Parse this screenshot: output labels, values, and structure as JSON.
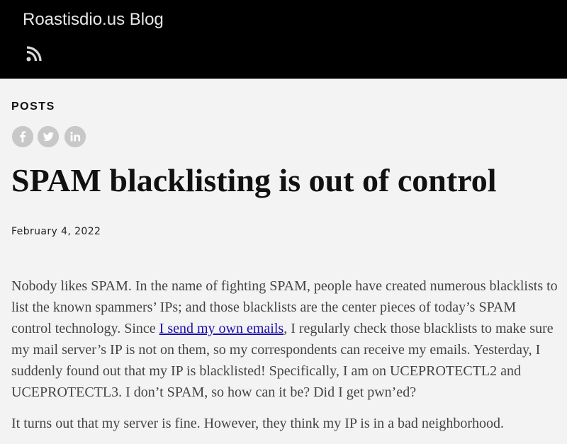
{
  "header": {
    "site_title": "Roastisdio.us Blog",
    "rss_icon": "rss-icon",
    "background": "#000000"
  },
  "section": {
    "label": "POSTS"
  },
  "share": {
    "icons": [
      "facebook-icon",
      "twitter-icon",
      "linkedin-icon"
    ]
  },
  "post": {
    "title": "SPAM blacklisting is out of control",
    "date": "February 4, 2022",
    "paragraph1": {
      "before_link": "Nobody likes SPAM. In the name of fighting SPAM, people have created numerous blacklists to list the known spammers’ IPs; and those blacklists are the center pieces of today’s SPAM control technology. Since ",
      "link_text": "I send my own emails",
      "after_link": ", I regularly check those blacklists to make sure my mail server’s IP is not on them, so my correspondents can receive my emails. Yesterday, I suddenly found out that my IP is blacklisted! Specifically, I am on UCEPROTECTL2 and UCEPROTECTL3. I don’t SPAM, so how can it be? Did I get pwn’ed?"
    },
    "paragraph2_partial": "It turns out that my server is fine. However, they think my IP is in a bad neighborhood."
  },
  "colors": {
    "page_background": "#f3f3f3",
    "link": "#1a0dab",
    "icon_circle": "#c8c8c8"
  }
}
